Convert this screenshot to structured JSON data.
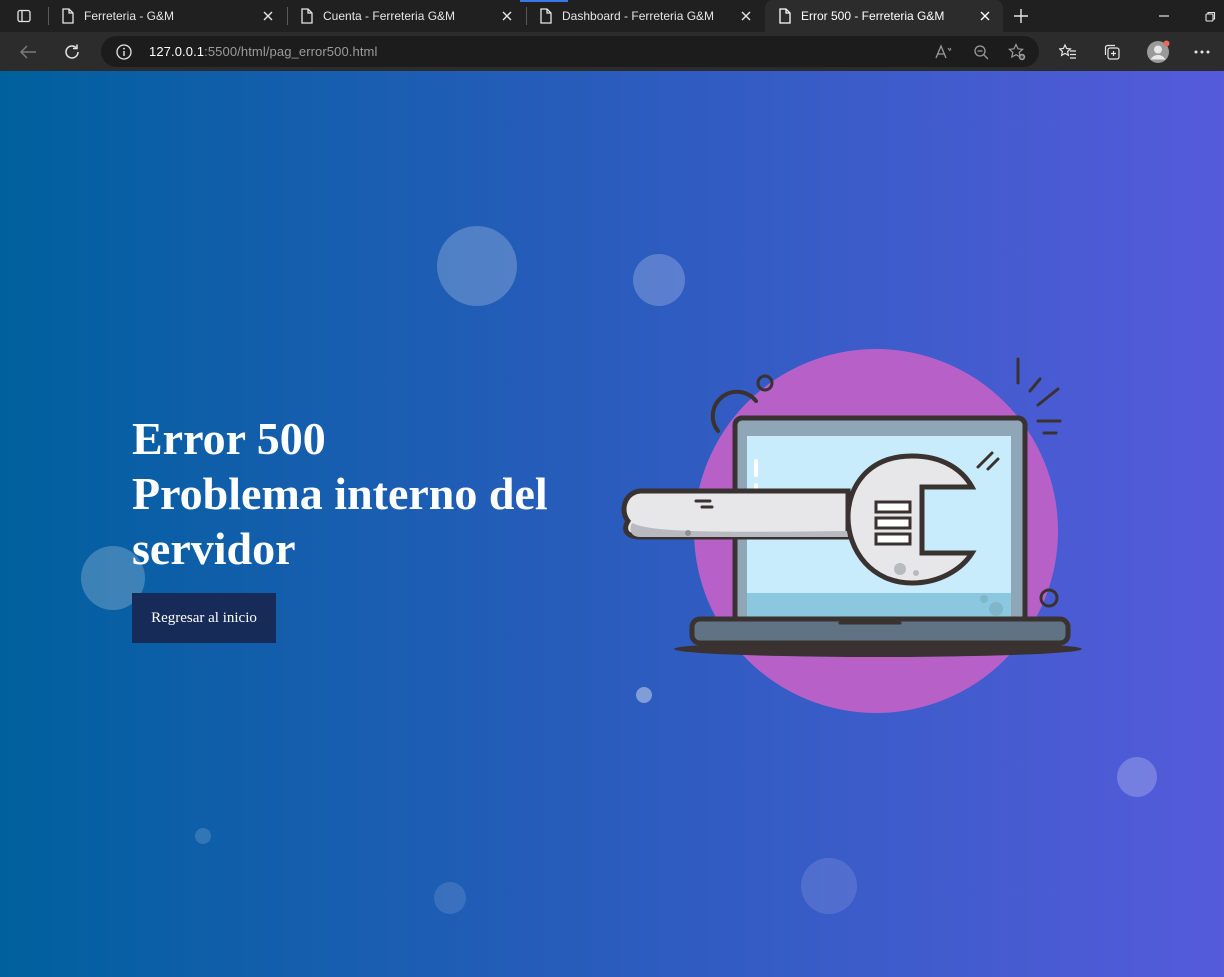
{
  "browser": {
    "tabs": [
      {
        "title": "Ferreteria - G&M",
        "active": false
      },
      {
        "title": "Cuenta - Ferreteria G&M",
        "active": false
      },
      {
        "title": "Dashboard - Ferreteria G&M",
        "active": false
      },
      {
        "title": "Error 500 - Ferreteria G&M",
        "active": true
      }
    ],
    "address": {
      "host": "127.0.0.1",
      "path": ":5500/html/pag_error500.html"
    }
  },
  "page": {
    "title_lines": [
      "Error 500",
      "Problema interno del",
      "servidor"
    ],
    "button_label": "Regresar al inicio",
    "colors": {
      "gradient_start": "#00609e",
      "gradient_end": "#555bdb",
      "button_bg": "#172b58",
      "illustration_circle": "#b761c8",
      "screen": "#c8ecfb"
    },
    "illustration_icon": "laptop-wrench-icon"
  }
}
